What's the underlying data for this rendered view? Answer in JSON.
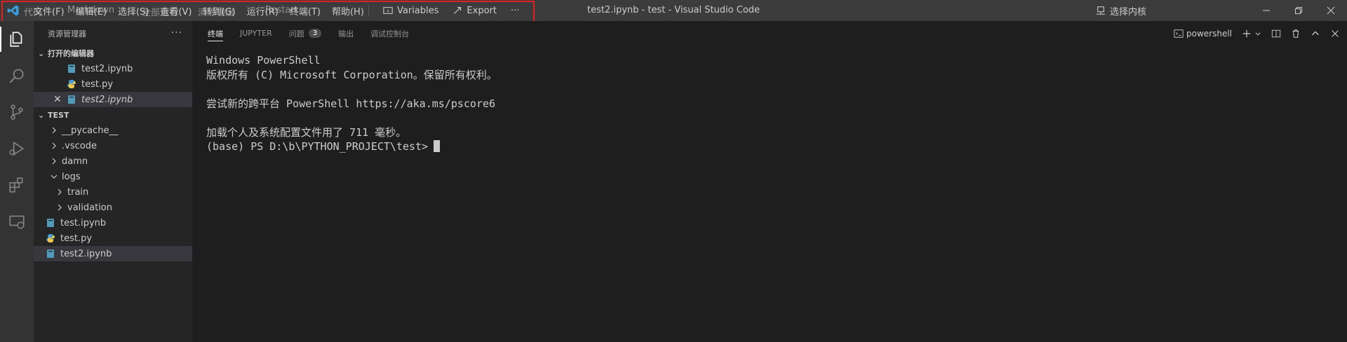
{
  "titlebar": {
    "window_title": "test2.ipynb - test - Visual Studio Code",
    "menu": [
      "文件(F)",
      "编辑(E)",
      "选择(S)",
      "查看(V)",
      "转到(G)",
      "运行(R)",
      "终端(T)",
      "帮助(H)"
    ],
    "ghost_items": [
      "代码",
      "Markdown",
      "全部运行",
      "清除输出",
      "Restart"
    ],
    "toolbar": [
      {
        "label": "Variables",
        "icon": "variables-icon"
      },
      {
        "label": "Export",
        "icon": "export-icon"
      }
    ],
    "more": "···",
    "kernel_label": "选择内核"
  },
  "sidebar": {
    "header": "资源管理器",
    "more": "···",
    "open_editors": {
      "title": "打开的编辑器",
      "items": [
        {
          "label": "test2.ipynb",
          "icon": "notebook-icon",
          "italic": false
        },
        {
          "label": "test.py",
          "icon": "python-icon",
          "italic": false
        },
        {
          "label": "test2.ipynb",
          "icon": "notebook-icon",
          "italic": true
        }
      ],
      "close": "✕"
    },
    "workspace": {
      "title": "TEST",
      "items": [
        {
          "label": "__pycache__",
          "kind": "folder",
          "depth": 0,
          "expanded": false
        },
        {
          "label": ".vscode",
          "kind": "folder",
          "depth": 0,
          "expanded": false
        },
        {
          "label": "damn",
          "kind": "folder",
          "depth": 0,
          "expanded": false
        },
        {
          "label": "logs",
          "kind": "folder",
          "depth": 0,
          "expanded": true
        },
        {
          "label": "train",
          "kind": "folder",
          "depth": 1,
          "expanded": false
        },
        {
          "label": "validation",
          "kind": "folder",
          "depth": 1,
          "expanded": false
        },
        {
          "label": "test.ipynb",
          "kind": "notebook",
          "depth": 0
        },
        {
          "label": "test.py",
          "kind": "python",
          "depth": 0
        },
        {
          "label": "test2.ipynb",
          "kind": "notebook",
          "depth": 0,
          "selected": true
        }
      ]
    }
  },
  "panel": {
    "tabs": [
      {
        "label": "终端",
        "active": true
      },
      {
        "label": "JUPYTER"
      },
      {
        "label": "问题",
        "badge": "3"
      },
      {
        "label": "输出"
      },
      {
        "label": "调试控制台"
      }
    ],
    "shell_label": "powershell",
    "terminal_lines": [
      "Windows PowerShell",
      "版权所有 (C) Microsoft Corporation。保留所有权利。",
      "",
      "尝试新的跨平台 PowerShell https://aka.ms/pscore6",
      "",
      "加载个人及系统配置文件用了 711 毫秒。",
      "(base) PS D:\\b\\PYTHON_PROJECT\\test>"
    ]
  },
  "colors": {
    "titlebar": "#3c3c3c",
    "activitybar": "#333333",
    "sidebar": "#252526",
    "editor": "#1e1e1e",
    "highlight_border": "#e02020",
    "notebook_icon": "#519aba",
    "python_icon": "#4b9cd3"
  }
}
